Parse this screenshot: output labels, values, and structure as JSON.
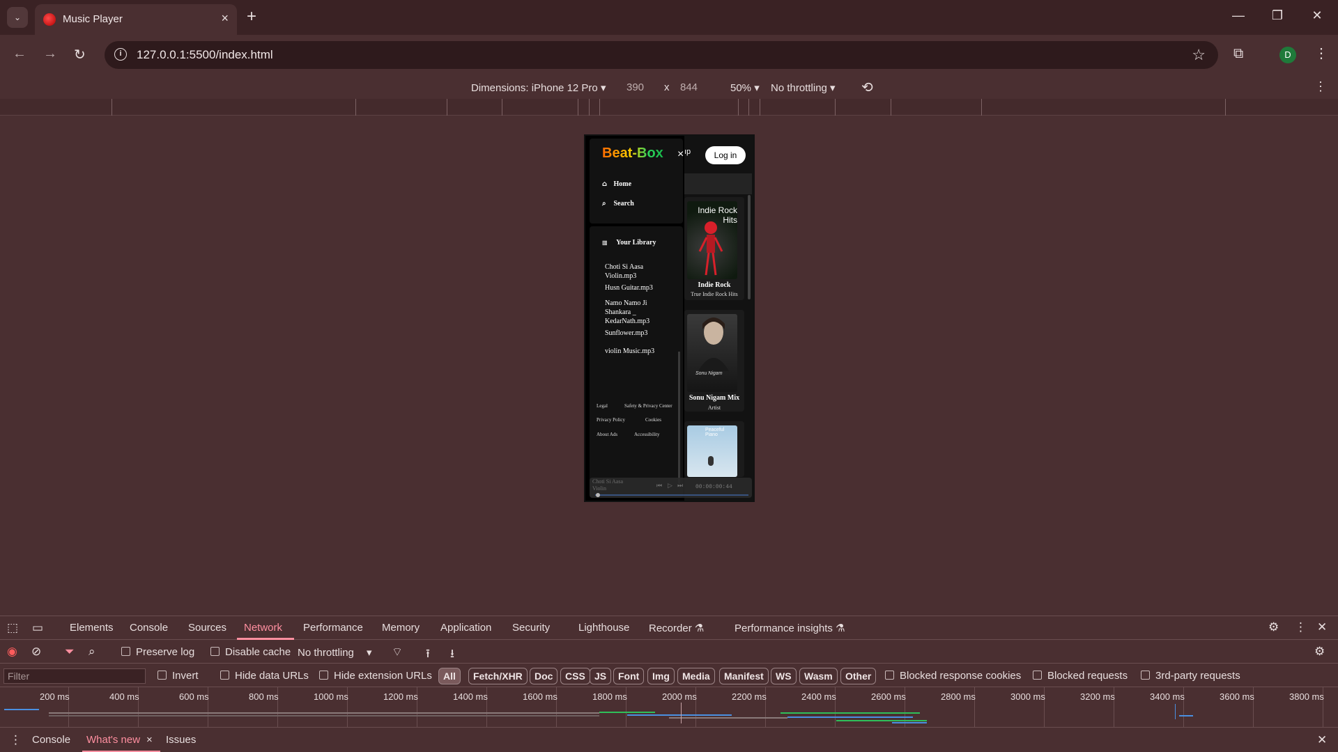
{
  "browser": {
    "tab_title": "Music Player",
    "url": "127.0.0.1:5500/index.html",
    "profile_initial": "D"
  },
  "device_toolbar": {
    "dimensions_label": "Dimensions: iPhone 12 Pro",
    "width": "390",
    "times": "x",
    "height": "844",
    "zoom": "50%",
    "throttling": "No throttling"
  },
  "app": {
    "brand": "Beat-Box",
    "close": "×",
    "header_fragment": "ıp",
    "login_label": "Log in",
    "nav": [
      {
        "label": "Home",
        "icon": "home-icon"
      },
      {
        "label": "Search",
        "icon": "search-icon"
      }
    ],
    "library_title": "Your Library",
    "songs": [
      "Choti Si Aasa Violin.mp3",
      "Husn Guitar.mp3",
      "Namo Namo Ji Shankara _ KedarNath.mp3",
      "Sunflower.mp3",
      "violin Music.mp3"
    ],
    "footer_links": [
      "Legal",
      "Safety & Privacy Center",
      "Privacy Policy",
      "Cookies",
      "About Ads",
      "Accessibility"
    ],
    "cards": [
      {
        "art_text": "Indie Rock Hits",
        "title": "Indie Rock",
        "subtitle": "True Indie Rock Hits"
      },
      {
        "art_text": "Sonu Nigam",
        "title": "Sonu Nigam Mix",
        "subtitle": "Artist"
      },
      {
        "art_text": "Peaceful Piano",
        "title": "",
        "subtitle": ""
      }
    ],
    "player": {
      "current_song": "Choti Si Aasa Violin",
      "time": "00:00:00:44",
      "progress": 0.02
    }
  },
  "devtools": {
    "tabs": [
      "Elements",
      "Console",
      "Sources",
      "Network",
      "Performance",
      "Memory",
      "Application",
      "Security",
      "Lighthouse",
      "Recorder",
      "Performance insights"
    ],
    "active_tab": "Network",
    "preserve_log": "Preserve log",
    "disable_cache": "Disable cache",
    "throttling": "No throttling",
    "filter_placeholder": "Filter",
    "invert": "Invert",
    "hide_data_urls": "Hide data URLs",
    "hide_extension_urls": "Hide extension URLs",
    "type_filters": [
      "All",
      "Fetch/XHR",
      "Doc",
      "CSS",
      "JS",
      "Font",
      "Img",
      "Media",
      "Manifest",
      "WS",
      "Wasm",
      "Other"
    ],
    "blocked_response_cookies": "Blocked response cookies",
    "blocked_requests": "Blocked requests",
    "third_party_requests": "3rd-party requests",
    "timeline_labels": [
      "200 ms",
      "400 ms",
      "600 ms",
      "800 ms",
      "1000 ms",
      "1200 ms",
      "1400 ms",
      "1600 ms",
      "1800 ms",
      "2000 ms",
      "2200 ms",
      "2400 ms",
      "2600 ms",
      "2800 ms",
      "3000 ms",
      "3200 ms",
      "3400 ms",
      "3600 ms",
      "3800 ms"
    ],
    "drawer_tabs": [
      "Console",
      "What's new",
      "Issues"
    ]
  },
  "colors": {
    "page_bg": "#4a2f31",
    "accent": "#ff8fa0",
    "brand_gradient": [
      "#ff6a00",
      "#ffcc00",
      "#2fd35a"
    ]
  }
}
